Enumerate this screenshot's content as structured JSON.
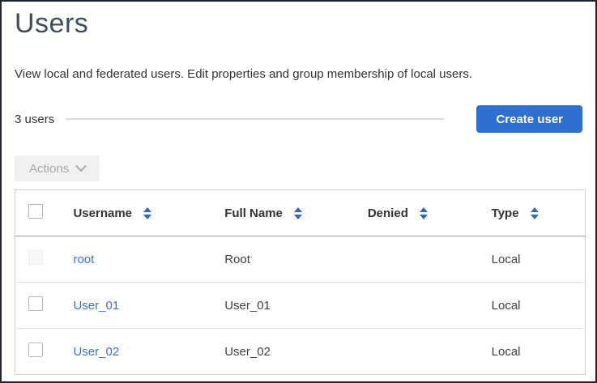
{
  "page": {
    "title": "Users",
    "description": "View local and federated users. Edit properties and group membership of local users.",
    "count_label": "3 users",
    "create_button_label": "Create user",
    "actions_button_label": "Actions"
  },
  "icons": {
    "actions_chevron": "chevron-down-icon",
    "sort": "sort-arrows-icon"
  },
  "colors": {
    "primary_button": "#2d70d0",
    "link": "#3d70c8",
    "sort_icon": "#3266c2",
    "title_text": "#3f4e5d",
    "window_border": "#1c2732"
  },
  "table": {
    "columns": [
      {
        "label": "Username",
        "sortable": true
      },
      {
        "label": "Full Name",
        "sortable": true
      },
      {
        "label": "Denied",
        "sortable": true
      },
      {
        "label": "Type",
        "sortable": true
      }
    ],
    "rows": [
      {
        "username": "root",
        "full_name": "Root",
        "denied": "",
        "type": "Local",
        "checkbox_disabled": true
      },
      {
        "username": "User_01",
        "full_name": "User_01",
        "denied": "",
        "type": "Local",
        "checkbox_disabled": false
      },
      {
        "username": "User_02",
        "full_name": "User_02",
        "denied": "",
        "type": "Local",
        "checkbox_disabled": false
      }
    ]
  }
}
